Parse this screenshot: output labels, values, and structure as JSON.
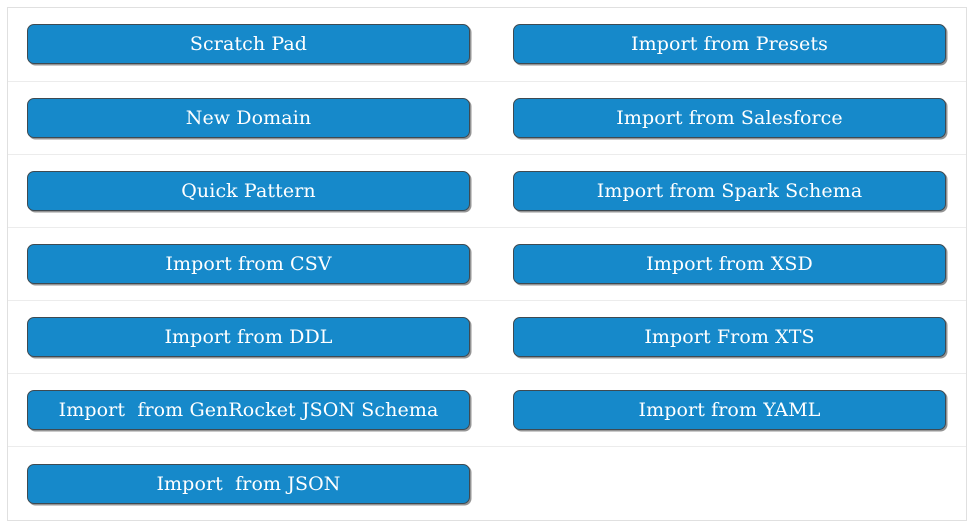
{
  "panel": {
    "accent_color": "#1689ca",
    "button_border_color": "#3e4a52",
    "button_text_color": "#ffffff",
    "row_divider_color": "#ececec",
    "panel_border_color": "#e0e0e0",
    "background_color": "#ffffff"
  },
  "rows": [
    {
      "left": {
        "label": "Scratch Pad"
      },
      "right": {
        "label": "Import from Presets"
      }
    },
    {
      "left": {
        "label": "New Domain"
      },
      "right": {
        "label": "Import from Salesforce"
      }
    },
    {
      "left": {
        "label": "Quick Pattern"
      },
      "right": {
        "label": "Import from Spark Schema"
      }
    },
    {
      "left": {
        "label": "Import from CSV"
      },
      "right": {
        "label": "Import from XSD"
      }
    },
    {
      "left": {
        "label": "Import from DDL"
      },
      "right": {
        "label": "Import From XTS"
      }
    },
    {
      "left": {
        "label": "Import  from GenRocket JSON Schema"
      },
      "right": {
        "label": "Import from YAML"
      }
    },
    {
      "left": {
        "label": "Import  from JSON"
      },
      "right": {
        "label": ""
      }
    }
  ]
}
